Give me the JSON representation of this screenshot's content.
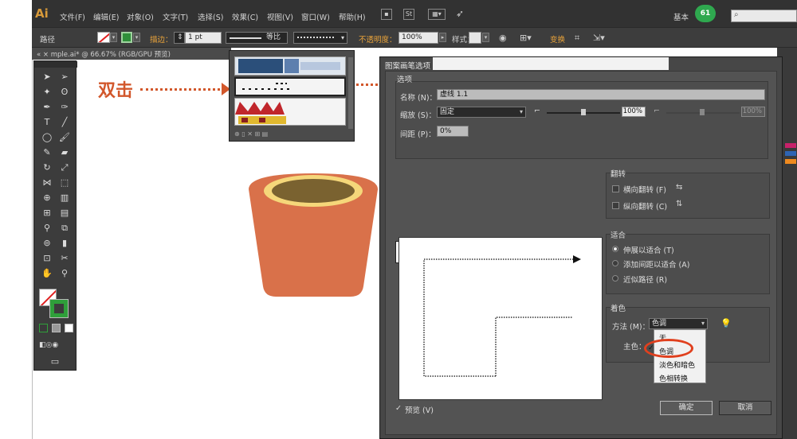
{
  "app": {
    "logo": "Ai"
  },
  "menubar": {
    "items": [
      "文件(F)",
      "编辑(E)",
      "对象(O)",
      "文字(T)",
      "选择(S)",
      "效果(C)",
      "视图(V)",
      "窗口(W)",
      "帮助(H)"
    ],
    "icon_st": "St",
    "workspace": "基本",
    "badge": "61",
    "search_icon": "⌕"
  },
  "controlbar": {
    "object_label": "路径",
    "stroke_label": "描边：",
    "stroke_weight": "1 pt",
    "profile_label": "等比",
    "opacity_label": "不透明度：",
    "opacity_value": "100%",
    "style_label": "样式：",
    "transform_label": "变换"
  },
  "doc_tab": {
    "title": "« × mple.ai* @ 66.67% (RGB/GPU 预览)"
  },
  "annotation": {
    "text": "双击"
  },
  "dialog": {
    "title": "图案画笔选项",
    "options_label": "选项",
    "name_label": "名称 (N)：",
    "name_value": "虚线 1.1",
    "scale_label": "缩放 (S)：",
    "scale_value": "固定",
    "scale_pct": "100%",
    "scale_pct2": "100%",
    "spacing_label": "间距 (P)：",
    "spacing_value": "0%",
    "flip_label": "翻转",
    "flip_h": "横向翻转 (F)",
    "flip_v": "纵向翻转 (C)",
    "fit_label": "适合",
    "fit_stretch": "伸展以适合 (T)",
    "fit_space": "添加间距以适合 (A)",
    "fit_approx": "近似路径 (R)",
    "color_label": "着色",
    "method_label": "方法 (M)：",
    "method_value": "色调",
    "key_color_label": "主色：",
    "preview_label": "预览 (V)",
    "ok_label": "确定",
    "cancel_label": "取消",
    "dropdown_options": [
      "无",
      "色调",
      "淡色和暗色",
      "色相转换"
    ],
    "check_mark": "✓"
  },
  "colors": {
    "accent_orange": "#d2572b",
    "pot_body": "#d9714a",
    "pot_rim": "#f5d77a",
    "pot_inside": "#7a6230",
    "stroke_green": "#2f9f3a"
  }
}
